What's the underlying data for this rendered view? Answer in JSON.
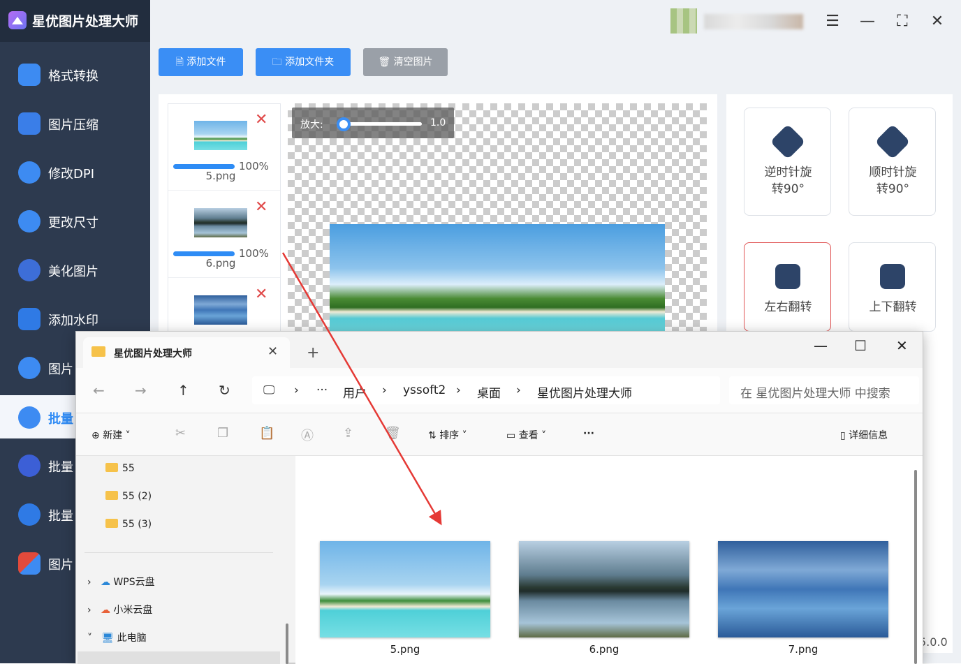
{
  "app": {
    "title": "星优图片处理大师"
  },
  "sidebar": {
    "items": [
      {
        "label": "格式转换",
        "icon": "image-convert-icon",
        "color": "#3d8bf2"
      },
      {
        "label": "图片压缩",
        "icon": "image-compress-icon",
        "color": "#3a7ee8"
      },
      {
        "label": "修改DPI",
        "icon": "dpi-icon",
        "color": "#3d8bf2"
      },
      {
        "label": "更改尺寸",
        "icon": "resize-icon",
        "color": "#3d8bf2"
      },
      {
        "label": "美化图片",
        "icon": "beautify-icon",
        "color": "#3d6ed8"
      },
      {
        "label": "添加水印",
        "icon": "watermark-icon",
        "color": "#2f7ae5"
      },
      {
        "label": "图片",
        "icon": "image-tool-icon",
        "color": "#3d8bf2"
      },
      {
        "label": "批量",
        "icon": "batch-icon",
        "color": "#3d8bf2"
      },
      {
        "label": "批量",
        "icon": "batch-edit-icon",
        "color": "#3c5fd6"
      },
      {
        "label": "批量",
        "icon": "batch-crop-icon",
        "color": "#2f7ae5"
      },
      {
        "label": "图片",
        "icon": "puzzle-icon",
        "color": "#e24a3b"
      }
    ]
  },
  "toolbar": {
    "add_file": "添加文件",
    "add_folder": "添加文件夹",
    "clear": "清空图片"
  },
  "files": [
    {
      "name": "5.png",
      "progress": "100%"
    },
    {
      "name": "6.png",
      "progress": "100%"
    },
    {
      "name": "",
      "progress": ""
    }
  ],
  "zoom": {
    "label": "放大:",
    "value": "1.0"
  },
  "tools": {
    "rotate_ccw": [
      "逆时针旋",
      "转90°"
    ],
    "rotate_cw": [
      "顺时针旋",
      "转90°"
    ],
    "flip_h": "左右翻转",
    "flip_v": "上下翻转"
  },
  "version_fragment": "5.0.0",
  "explorer": {
    "tab_title": "星优图片处理大师",
    "breadcrumb": [
      "用户",
      "yssoft2",
      "桌面",
      "星优图片处理大师"
    ],
    "search_placeholder": "在 星优图片处理大师 中搜索",
    "commands": {
      "new": "新建",
      "sort": "排序",
      "view": "查看",
      "details": "详细信息"
    },
    "tree": [
      {
        "label": "55",
        "type": "folder"
      },
      {
        "label": "55 (2)",
        "type": "folder"
      },
      {
        "label": "55 (3)",
        "type": "folder"
      },
      {
        "label": "WPS云盘",
        "type": "cloud"
      },
      {
        "label": "小米云盘",
        "type": "cloud"
      },
      {
        "label": "此电脑",
        "type": "pc"
      }
    ],
    "files": [
      {
        "name": "5.png"
      },
      {
        "name": "6.png"
      },
      {
        "name": "7.png"
      }
    ]
  }
}
